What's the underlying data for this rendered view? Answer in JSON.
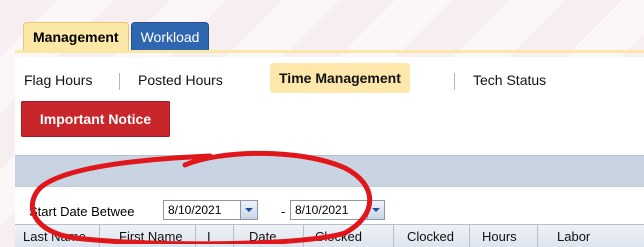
{
  "top_tabs": [
    {
      "label": "Management"
    },
    {
      "label": "Workload"
    }
  ],
  "subnav": [
    {
      "label": "Flag Hours"
    },
    {
      "label": "Posted Hours"
    },
    {
      "label": "Time Management"
    },
    {
      "label": "Tech Status"
    }
  ],
  "notice_button": "Important Notice",
  "filter": {
    "label": "Start Date Betwee",
    "start_value": "8/10/2021",
    "dash": "-",
    "end_value": "8/10/2021"
  },
  "columns": [
    "Last Name",
    "First Name",
    "I",
    "Date",
    "Clocked",
    "Clocked",
    "Hours",
    "Labor"
  ],
  "colors": {
    "active_tab": "#fbe7a6",
    "inactive_tab": "#2f66b0",
    "notice": "#c8262a",
    "annotation": "#e0161b"
  }
}
